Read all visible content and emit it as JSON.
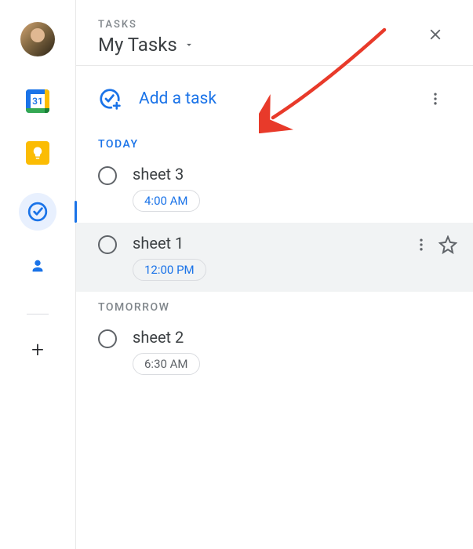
{
  "header": {
    "label": "TASKS",
    "list_title": "My Tasks"
  },
  "add_task": {
    "label": "Add a task"
  },
  "sections": {
    "today_label": "TODAY",
    "tomorrow_label": "TOMORROW"
  },
  "tasks": {
    "today": [
      {
        "title": "sheet 3",
        "time": "4:00 AM"
      },
      {
        "title": "sheet 1",
        "time": "12:00 PM"
      }
    ],
    "tomorrow": [
      {
        "title": "sheet 2",
        "time": "6:30 AM"
      }
    ]
  },
  "sidebar": {
    "calendar_day": "31"
  }
}
